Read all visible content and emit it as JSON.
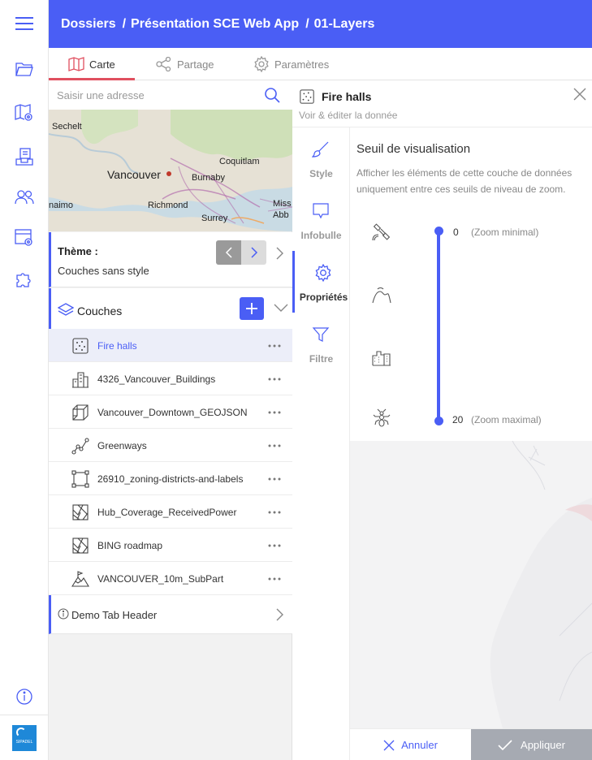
{
  "header": {
    "breadcrumb": [
      "Dossiers",
      "Présentation SCE Web App",
      "01-Layers"
    ],
    "separator": "/"
  },
  "rail": {
    "items": [
      "menu-icon",
      "folder-icon",
      "map-settings-icon",
      "layers-stack-icon",
      "users-icon",
      "calendar-settings-icon",
      "puzzle-icon"
    ],
    "info": "info-icon",
    "logo_text": "SIPADEL"
  },
  "tabs": [
    {
      "label": "Carte",
      "icon": "map-icon",
      "active": true
    },
    {
      "label": "Partage",
      "icon": "share-icon",
      "active": false
    },
    {
      "label": "Paramètres",
      "icon": "gear-icon",
      "active": false
    }
  ],
  "search": {
    "placeholder": "Saisir une adresse"
  },
  "minimap": {
    "labels": [
      "Sechelt",
      "Coquitlam",
      "Vancouver",
      "Burnaby",
      "naimo",
      "Richmond",
      "Miss",
      "Surrey",
      "Abb"
    ]
  },
  "theme": {
    "label": "Thème :",
    "value": "Couches sans style"
  },
  "couches": {
    "label": "Couches"
  },
  "layers": [
    {
      "name": "Fire halls",
      "icon": "point-layer-icon",
      "selected": true
    },
    {
      "name": "4326_Vancouver_Buildings",
      "icon": "buildings-icon",
      "selected": false
    },
    {
      "name": "Vancouver_Downtown_GEOJSON",
      "icon": "cube-icon",
      "selected": false
    },
    {
      "name": "Greenways",
      "icon": "polyline-icon",
      "selected": false
    },
    {
      "name": "26910_zoning-districts-and-labels",
      "icon": "polygon-icon",
      "selected": false
    },
    {
      "name": "Hub_Coverage_ReceivedPower",
      "icon": "raster-icon",
      "selected": false
    },
    {
      "name": "BING roadmap",
      "icon": "raster-icon",
      "selected": false
    },
    {
      "name": "VANCOUVER_10m_SubPart",
      "icon": "terrain-icon",
      "selected": false
    }
  ],
  "demotab": {
    "label": "Demo Tab Header"
  },
  "panel": {
    "title": "Fire halls",
    "subtitle": "Voir & éditer la donnée",
    "vtabs": [
      {
        "label": "Style",
        "icon": "brush-icon",
        "active": false
      },
      {
        "label": "Infobulle",
        "icon": "tooltip-icon",
        "active": false
      },
      {
        "label": "Propriétés",
        "icon": "gear-icon",
        "active": true
      },
      {
        "label": "Filtre",
        "icon": "filter-icon",
        "active": false
      }
    ],
    "section_title": "Seuil de visualisation",
    "section_desc": "Afficher les éléments de cette couche de données uniquement entre ces seuils de niveau de zoom.",
    "zoom": {
      "min": "0",
      "min_label": "(Zoom minimal)",
      "max": "20",
      "max_label": "(Zoom maximal)",
      "icons": [
        "satellite-icon",
        "mountain-icon",
        "city-icon",
        "ant-icon"
      ]
    },
    "footer": {
      "cancel": "Annuler",
      "apply": "Appliquer"
    }
  },
  "colors": {
    "accent": "#4a5ef5",
    "tab_underline": "#e04f5f",
    "apply_bg": "#a6aab2"
  }
}
